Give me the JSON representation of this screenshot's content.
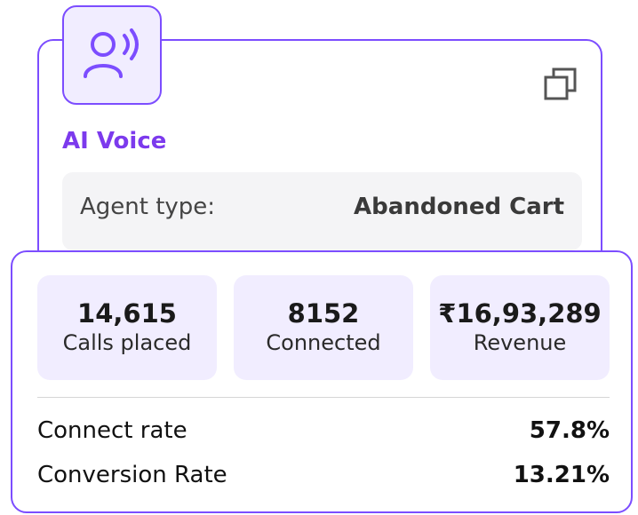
{
  "agent": {
    "icon": "voice-agent-icon",
    "title": "AI Voice",
    "type_label": "Agent type:",
    "type_value": "Abandoned Cart",
    "copy_icon": "copy-icon"
  },
  "stats": [
    {
      "value": "14,615",
      "label": "Calls placed"
    },
    {
      "value": "8152",
      "label": "Connected"
    },
    {
      "value": "₹16,93,289",
      "label": "Revenue"
    }
  ],
  "metrics": [
    {
      "label": "Connect rate",
      "value": "57.8%"
    },
    {
      "label": "Conversion Rate",
      "value": "13.21%"
    }
  ],
  "colors": {
    "accent": "#7c4dff",
    "title": "#7c3aed",
    "tile_bg": "#f1edff",
    "row_bg": "#f4f4f6"
  }
}
